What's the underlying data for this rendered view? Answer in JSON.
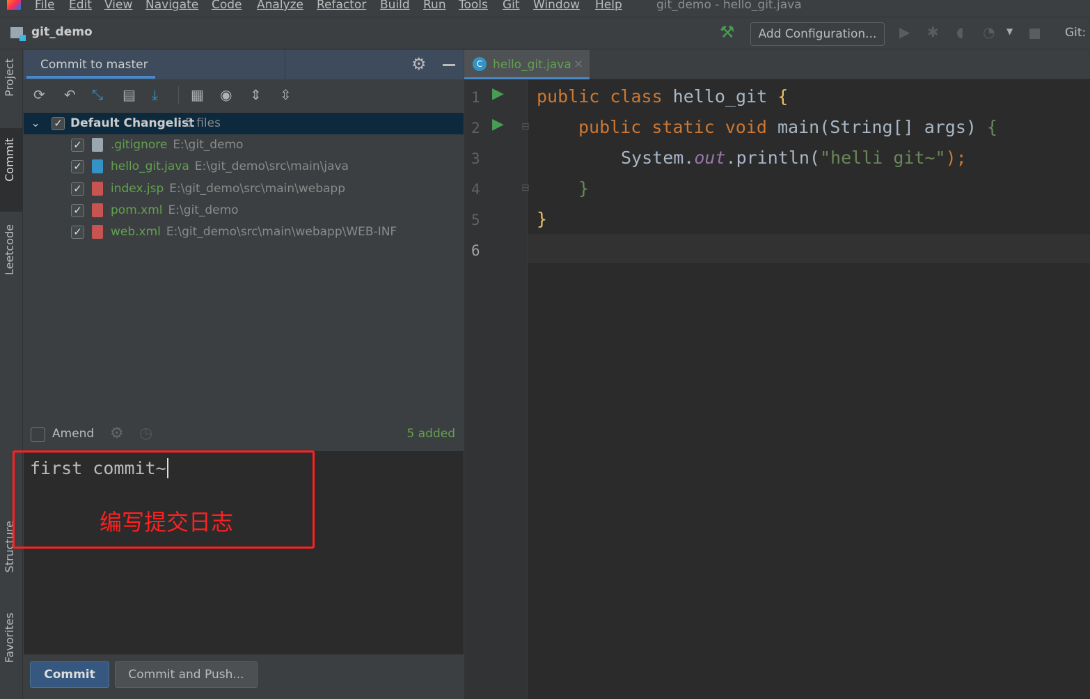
{
  "menu": [
    "File",
    "Edit",
    "View",
    "Navigate",
    "Code",
    "Analyze",
    "Refactor",
    "Build",
    "Run",
    "Tools",
    "Git",
    "Window",
    "Help"
  ],
  "window_title": "git_demo - hello_git.java",
  "nav": {
    "project": "git_demo",
    "add_config": "Add Configuration...",
    "git_label": "Git:"
  },
  "stripe": {
    "project": "Project",
    "commit": "Commit",
    "leetcode": "Leetcode",
    "structure": "Structure",
    "favorites": "Favorites"
  },
  "commit_panel": {
    "tab": "Commit to master",
    "changelist": {
      "name": "Default Changelist",
      "count": "5 files",
      "checked": true
    },
    "files": [
      {
        "name": ".gitignore",
        "path": "E:\\git_demo",
        "icon": "text-file-icon",
        "checked": true
      },
      {
        "name": "hello_git.java",
        "path": "E:\\git_demo\\src\\main\\java",
        "icon": "java-file-icon",
        "checked": true
      },
      {
        "name": "index.jsp",
        "path": "E:\\git_demo\\src\\main\\webapp",
        "icon": "jsp-file-icon",
        "checked": true
      },
      {
        "name": "pom.xml",
        "path": "E:\\git_demo",
        "icon": "xml-file-icon",
        "checked": true
      },
      {
        "name": "web.xml",
        "path": "E:\\git_demo\\src\\main\\webapp\\WEB-INF",
        "icon": "xml-file-icon",
        "checked": true
      }
    ],
    "amend": "Amend",
    "amend_checked": false,
    "status": "5 added",
    "message": "first commit~",
    "annotation": "编写提交日志",
    "commit_button": "Commit",
    "commit_push_button": "Commit and Push..."
  },
  "editor": {
    "tab": "hello_git.java",
    "line_numbers": [
      "1",
      "2",
      "3",
      "4",
      "5",
      "6"
    ],
    "code": {
      "l1": {
        "kw": "public class ",
        "name": "hello_git ",
        "brace": "{"
      },
      "l2": {
        "kw": "public static void ",
        "name": "main(String[] args) ",
        "brace": "{"
      },
      "l3": {
        "a": "System.",
        "fld": "out",
        "b": ".println(",
        "str": "\"helli git~\"",
        "c": ");"
      },
      "l4": "}",
      "l5": "}"
    }
  },
  "colors": {
    "accent": "#4a88c7",
    "annotation": "#ff2020",
    "added": "#62a14e"
  }
}
